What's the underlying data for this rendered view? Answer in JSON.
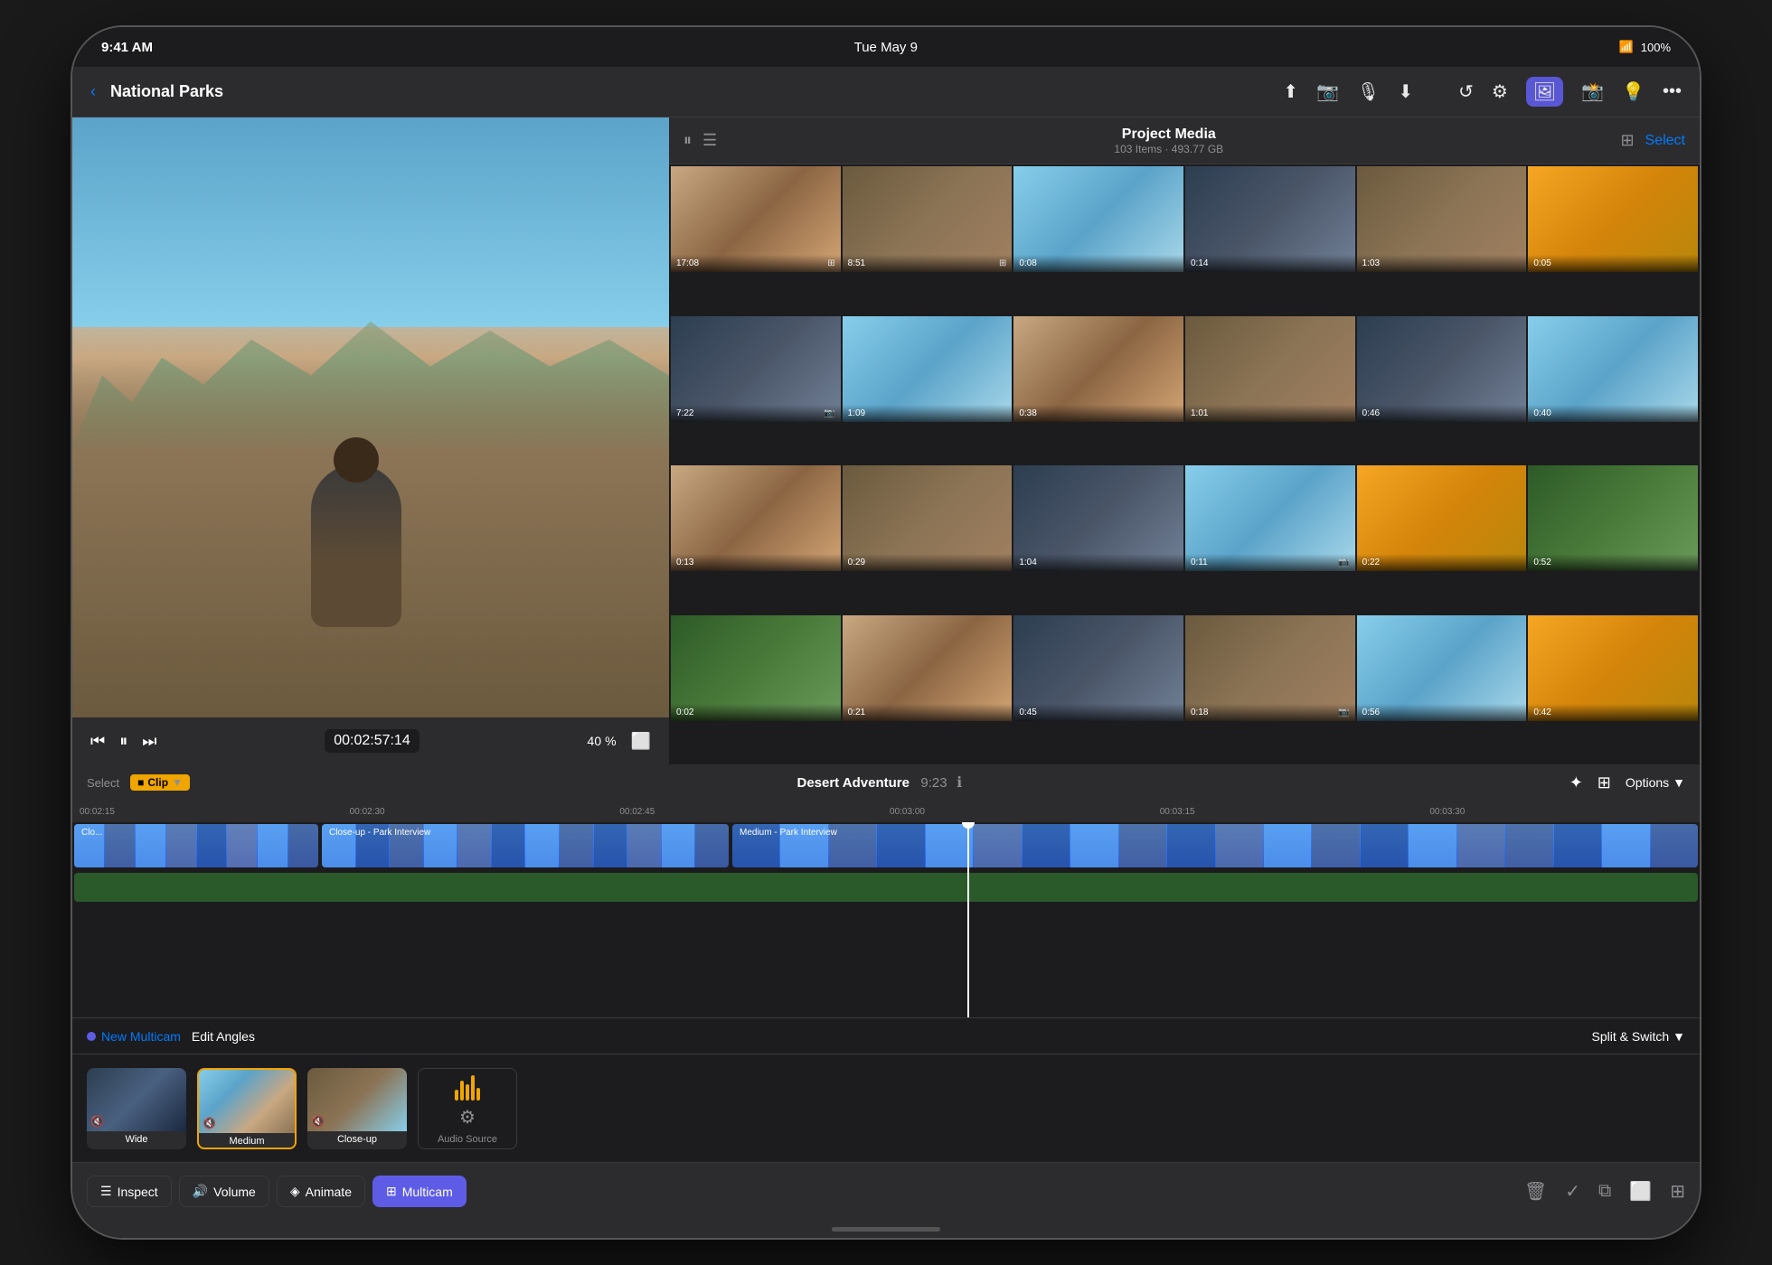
{
  "device": {
    "status_bar": {
      "time": "9:41 AM",
      "date": "Tue May 9",
      "wifi": "WiFi",
      "battery": "100%"
    }
  },
  "top_nav": {
    "back_label": "‹",
    "project_title": "National Parks",
    "icons": [
      "upload",
      "camera",
      "location",
      "share",
      "history",
      "settings",
      "photos",
      "camera2",
      "info",
      "more"
    ]
  },
  "media_browser": {
    "title": "Project Media",
    "subtitle": "103 Items · 493.77 GB",
    "select_label": "Select",
    "items": [
      {
        "duration": "17:08",
        "type": "grid"
      },
      {
        "duration": "8:51",
        "type": "grid"
      },
      {
        "duration": "0:08",
        "type": "video"
      },
      {
        "duration": "0:14",
        "type": "video"
      },
      {
        "duration": "1:03",
        "type": "video"
      },
      {
        "duration": "0:05",
        "type": "video"
      },
      {
        "duration": "7:22",
        "type": "camera"
      },
      {
        "duration": "1:09",
        "type": "video"
      },
      {
        "duration": "0:38",
        "type": "video"
      },
      {
        "duration": "1:01",
        "type": "video"
      },
      {
        "duration": "0:46",
        "type": "video"
      },
      {
        "duration": "0:40",
        "type": "video"
      },
      {
        "duration": "0:13",
        "type": "video"
      },
      {
        "duration": "0:29",
        "type": "video"
      },
      {
        "duration": "1:04",
        "type": "video"
      },
      {
        "duration": "0:11",
        "type": "camera"
      },
      {
        "duration": "0:22",
        "type": "video"
      },
      {
        "duration": "0:52",
        "type": "video"
      },
      {
        "duration": "0:02",
        "type": "video"
      },
      {
        "duration": "0:21",
        "type": "video"
      },
      {
        "duration": "0:45",
        "type": "video"
      },
      {
        "duration": "0:18",
        "type": "camera"
      },
      {
        "duration": "0:56",
        "type": "video"
      },
      {
        "duration": "0:42",
        "type": "video"
      }
    ]
  },
  "video_controls": {
    "timecode": "00:02:57:14",
    "volume": "40",
    "rewind_label": "⏮",
    "play_label": "⏸",
    "forward_label": "⏭"
  },
  "timeline": {
    "select_label": "Select",
    "clip_label": "Clip",
    "project_name": "Desert Adventure",
    "project_duration": "9:23",
    "ruler_marks": [
      "00:02:15",
      "00:02:30",
      "00:02:45",
      "00:03:00",
      "00:03:15",
      "00:03:30"
    ],
    "clips": [
      {
        "label": "Close-up - Park Interview",
        "color": "blue"
      },
      {
        "label": "Medium - Park Interview",
        "color": "blue"
      }
    ],
    "options_label": "Options"
  },
  "multicam": {
    "new_label": "New Multicam",
    "edit_angles_label": "Edit Angles",
    "split_switch_label": "Split & Switch",
    "angles": [
      {
        "name": "Wide",
        "active": false
      },
      {
        "name": "Medium",
        "active": true
      },
      {
        "name": "Close-up",
        "active": false
      },
      {
        "name": "Audio Source",
        "active": false
      }
    ]
  },
  "bottom_toolbar": {
    "inspect_label": "Inspect",
    "volume_label": "Volume",
    "animate_label": "Animate",
    "multicam_label": "Multicam",
    "active_tab": "Multicam"
  },
  "colors": {
    "accent": "#5e5ce6",
    "timeline_blue": "#3b82f6",
    "active_border": "#f0a500",
    "audio_green": "#2a5a2a",
    "text_primary": "#ffffff",
    "text_secondary": "#8e8e93"
  }
}
